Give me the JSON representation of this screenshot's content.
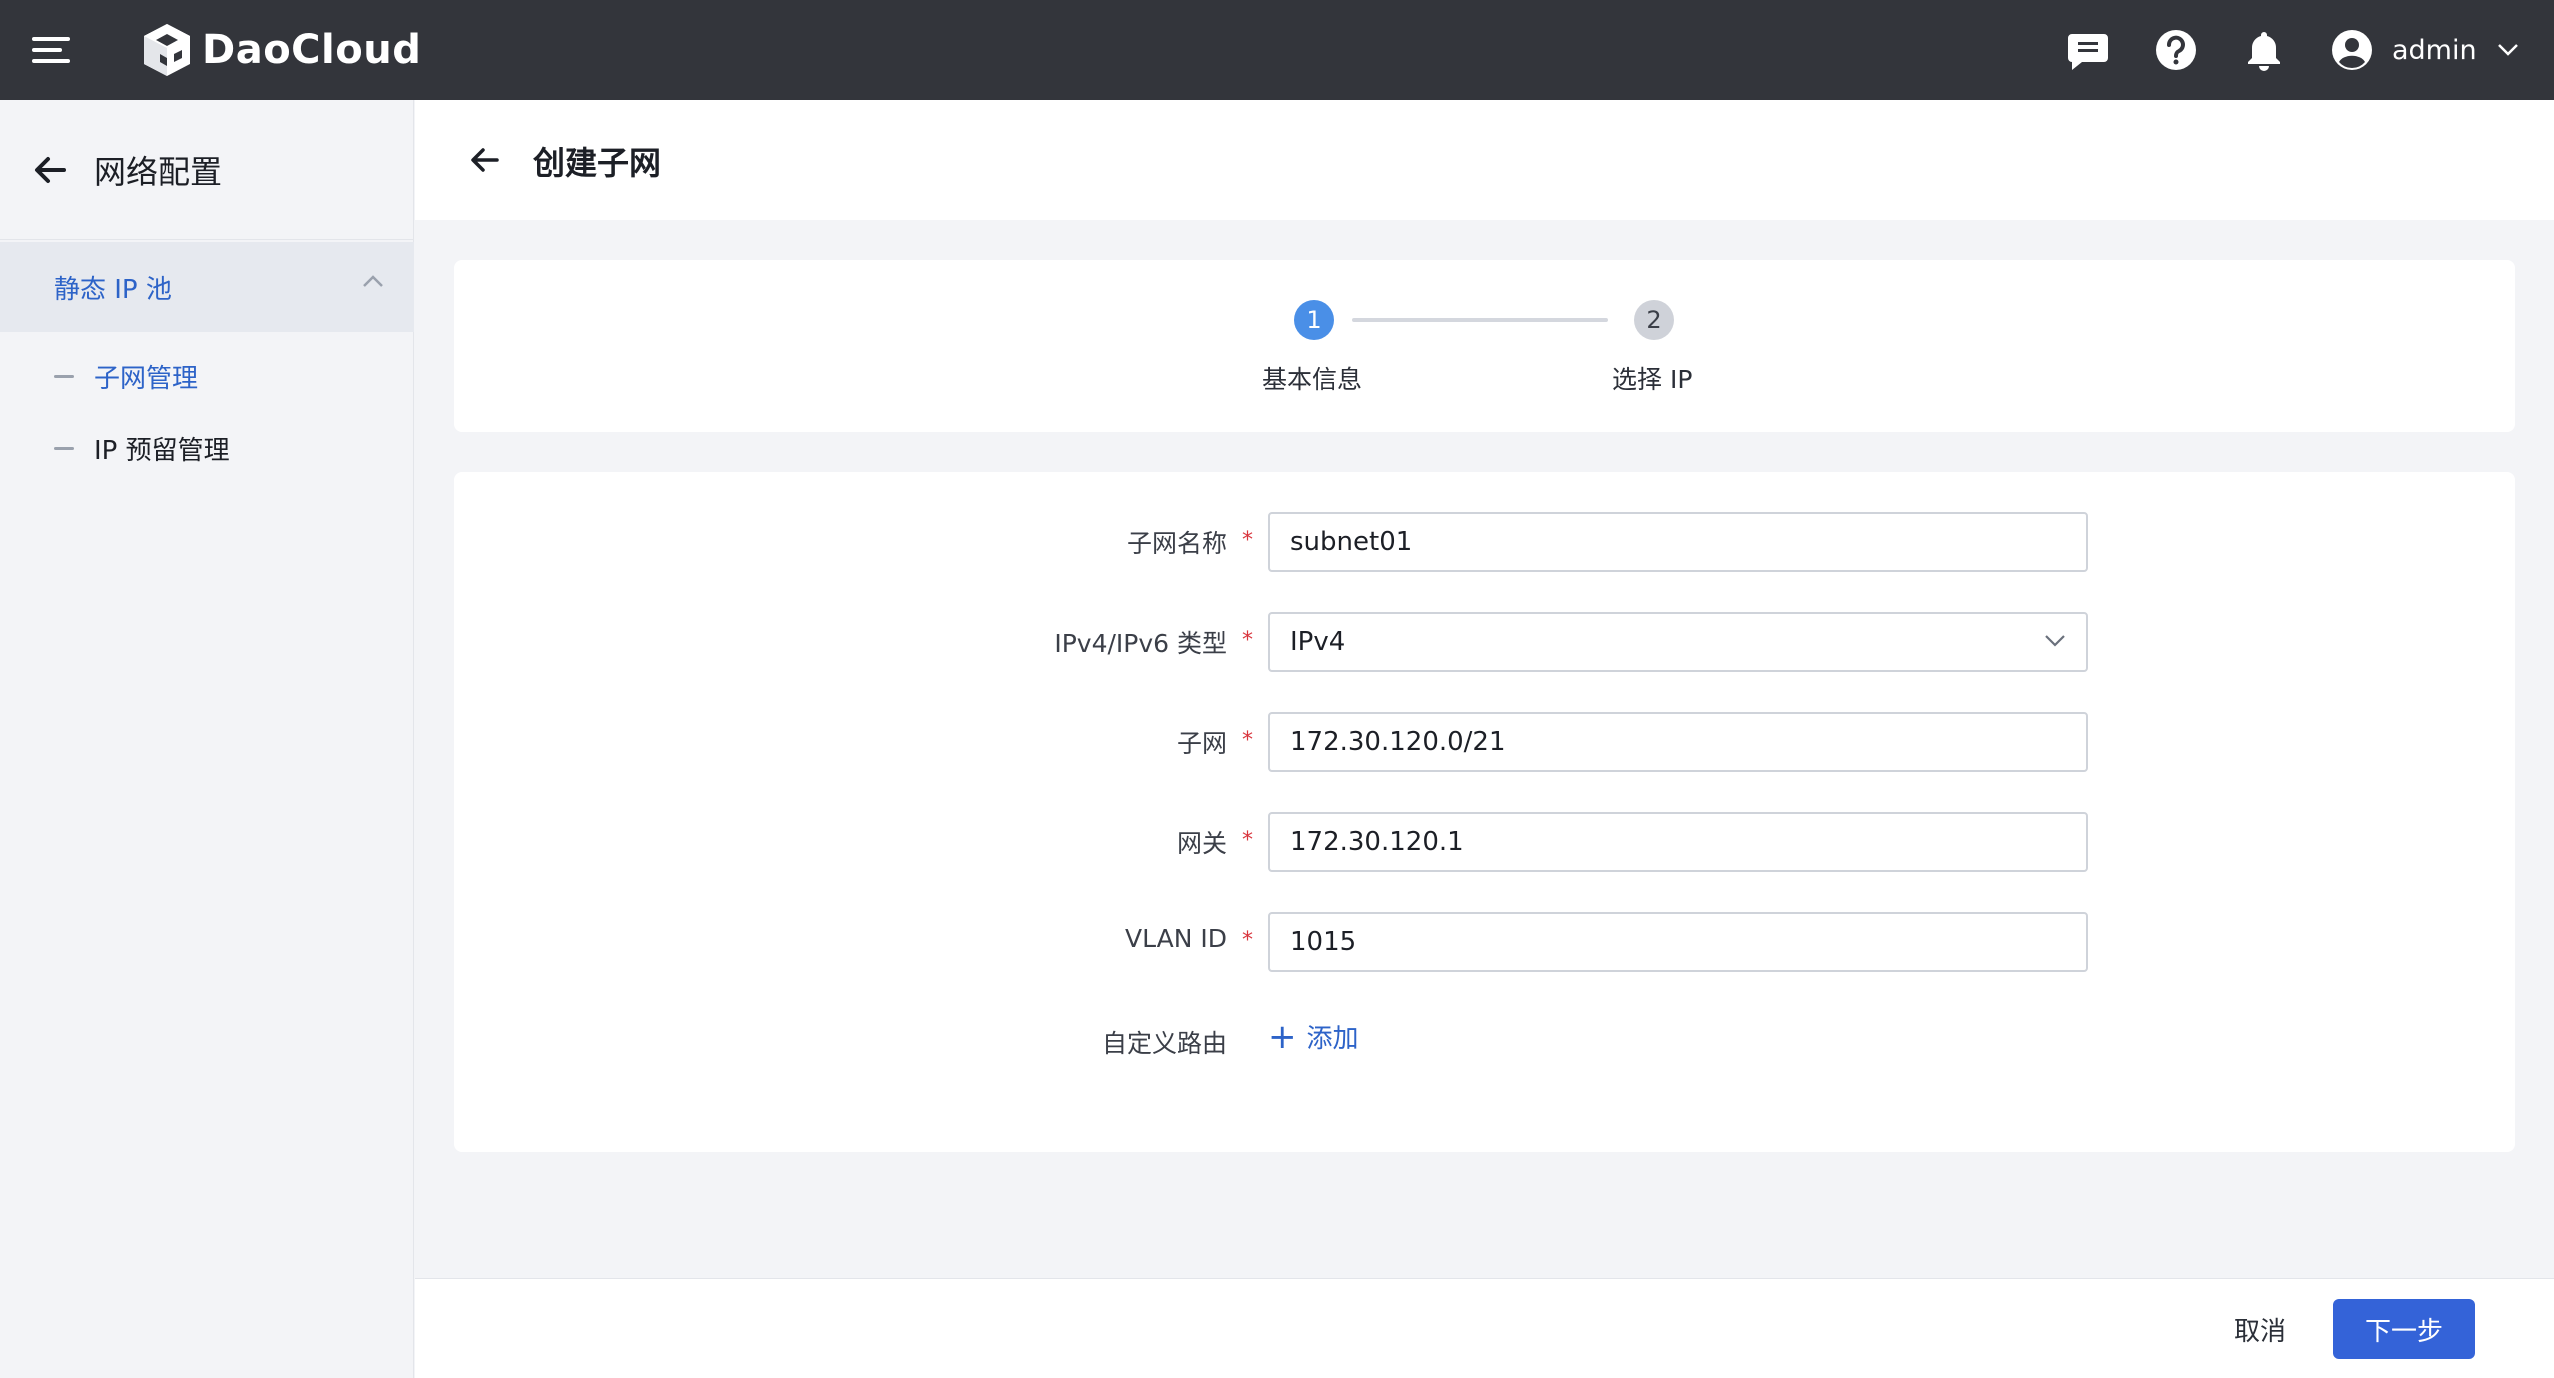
{
  "header": {
    "brand": "DaoCloud",
    "user_name": "admin",
    "icons": [
      "menu-icon",
      "logo-icon",
      "message-icon",
      "help-icon",
      "bell-icon",
      "user-avatar-icon",
      "chevron-down-icon"
    ]
  },
  "sidebar": {
    "title": "网络配置",
    "group": "静态 IP 池",
    "items": [
      {
        "label": "子网管理",
        "active": true
      },
      {
        "label": "IP 预留管理",
        "active": false
      }
    ]
  },
  "page": {
    "title": "创建子网"
  },
  "steps": [
    {
      "number": "1",
      "label": "基本信息",
      "status": "active"
    },
    {
      "number": "2",
      "label": "选择 IP",
      "status": "pending"
    }
  ],
  "form": {
    "subnet_name": {
      "label": "子网名称",
      "value": "subnet01",
      "required": true
    },
    "ip_type": {
      "label": "IPv4/IPv6 类型",
      "value": "IPv4",
      "required": true
    },
    "subnet": {
      "label": "子网",
      "value": "172.30.120.0/21",
      "required": true
    },
    "gateway": {
      "label": "网关",
      "value": "172.30.120.1",
      "required": true
    },
    "vlan_id": {
      "label": "VLAN ID",
      "value": "1015",
      "required": true
    },
    "custom_route": {
      "label": "自定义路由",
      "add_label": "添加"
    },
    "required_mark": "*"
  },
  "footer": {
    "cancel_label": "取消",
    "next_label": "下一步"
  },
  "colors": {
    "header_bg": "#33353b",
    "accent": "#3463d8",
    "step_active": "#4a8fe7",
    "required": "#d9363e"
  }
}
